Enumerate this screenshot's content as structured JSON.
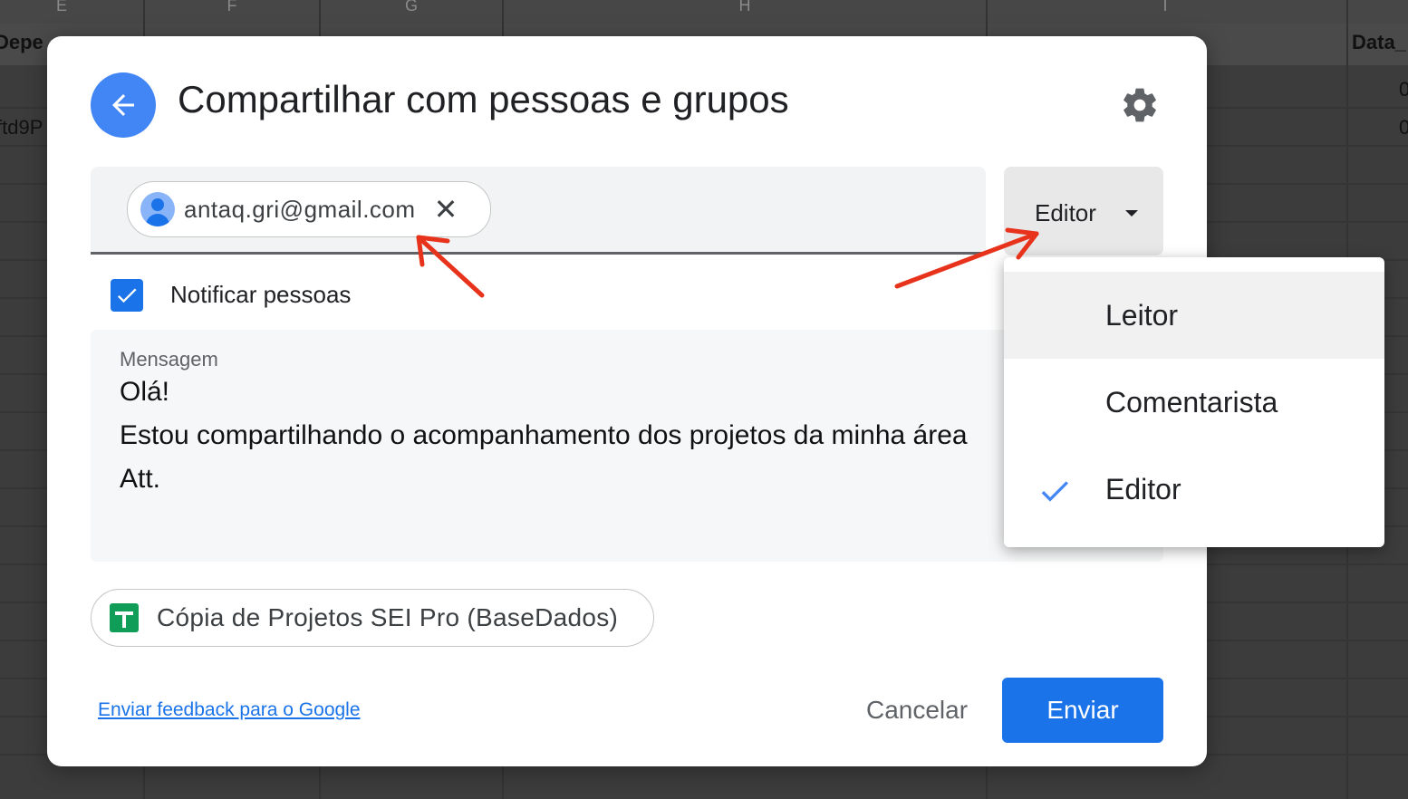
{
  "background_sheet": {
    "column_letters": [
      "E",
      "F",
      "G",
      "H",
      "I"
    ],
    "header_cells": [
      "Depe",
      "Data_"
    ],
    "cells": [
      "ftd9P",
      "0",
      "0"
    ]
  },
  "dialog": {
    "title": "Compartilhar com pessoas e grupos",
    "back_icon": "arrow-left-icon",
    "settings_icon": "gear-icon",
    "recipient": {
      "email": "antaq.gri@gmail.com",
      "avatar_icon": "person-avatar-icon",
      "remove_icon": "close-icon",
      "remove_glyph": "✕"
    },
    "role_selector": {
      "label": "Editor",
      "icon": "caret-down-icon"
    },
    "notify": {
      "label": "Notificar pessoas",
      "checked": true
    },
    "message": {
      "label": "Mensagem",
      "lines": [
        "Olá!",
        "Estou compartilhando o acompanhamento dos projetos da minha área",
        "Att."
      ]
    },
    "file": {
      "name": "Cópia de Projetos SEI Pro (BaseDados)",
      "icon": "google-sheets-icon"
    },
    "footer": {
      "feedback_link": "Enviar feedback para o Google",
      "cancel_label": "Cancelar",
      "send_label": "Enviar"
    }
  },
  "role_menu": {
    "items": [
      {
        "label": "Leitor",
        "selected": false,
        "highlighted": true
      },
      {
        "label": "Comentarista",
        "selected": false,
        "highlighted": false
      },
      {
        "label": "Editor",
        "selected": true,
        "highlighted": false
      }
    ],
    "selected_icon": "checkmark-icon"
  },
  "colors": {
    "primary_blue": "#1a73e8",
    "back_button_blue": "#4285f4",
    "annotation_red": "#e8331c",
    "sheets_green": "#0f9d58"
  }
}
